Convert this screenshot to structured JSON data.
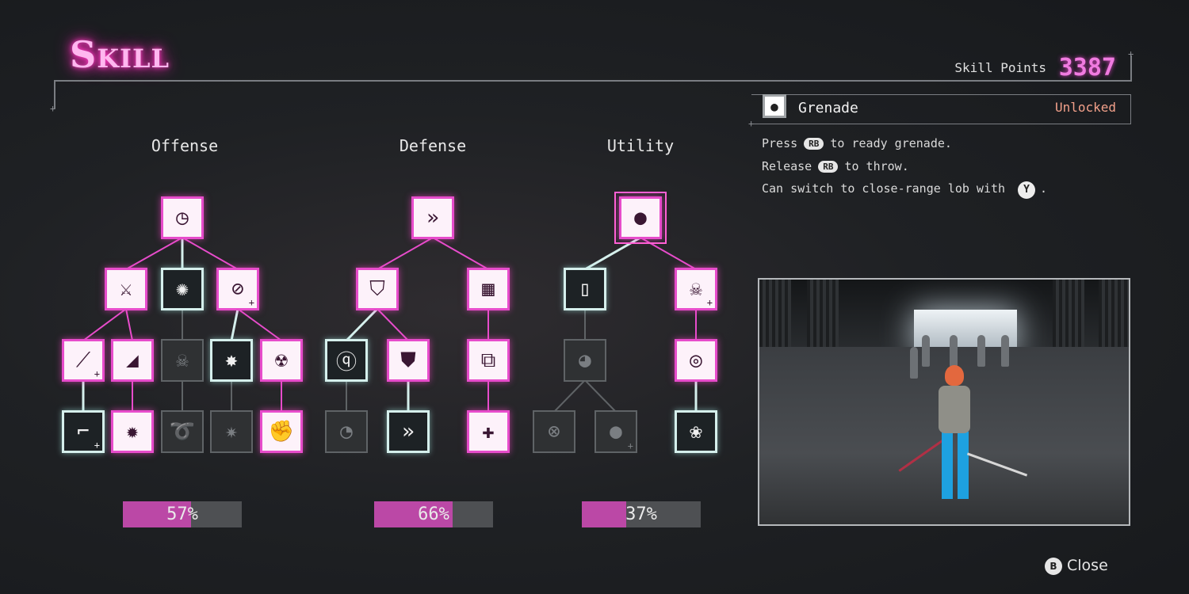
{
  "header": {
    "title": "Skill",
    "skill_points_label": "Skill Points",
    "skill_points_value": "3387"
  },
  "columns": [
    {
      "title": "Offense",
      "progress_label": "57%",
      "progress": 0.57
    },
    {
      "title": "Defense",
      "progress_label": "66%",
      "progress": 0.66
    },
    {
      "title": "Utility",
      "progress_label": "37%",
      "progress": 0.37
    }
  ],
  "nodes": {
    "offense_root": {
      "icon": "clock-icon",
      "state": "unlocked"
    },
    "offense_a1": {
      "icon": "slash-icon",
      "state": "unlocked"
    },
    "offense_a2": {
      "icon": "vortex-icon",
      "state": "active"
    },
    "offense_a3": {
      "icon": "crossed-dodge-icon",
      "state": "unlocked"
    },
    "offense_b1": {
      "icon": "blade-plus-icon",
      "state": "unlocked"
    },
    "offense_b2": {
      "icon": "wave-slash-icon",
      "state": "unlocked"
    },
    "offense_b3": {
      "icon": "skull-icon",
      "state": "locked"
    },
    "offense_b4": {
      "icon": "burst-icon",
      "state": "active"
    },
    "offense_b5": {
      "icon": "flame-skull-icon",
      "state": "unlocked"
    },
    "offense_c1": {
      "icon": "pistol-plus-icon",
      "state": "active"
    },
    "offense_c2": {
      "icon": "explosion-icon",
      "state": "unlocked"
    },
    "offense_c3": {
      "icon": "swirl-icon",
      "state": "locked"
    },
    "offense_c4": {
      "icon": "gear-burst-icon",
      "state": "locked"
    },
    "offense_c5": {
      "icon": "fist-icon",
      "state": "unlocked"
    },
    "defense_root": {
      "icon": "double-chevron-icon",
      "state": "unlocked"
    },
    "defense_a1": {
      "icon": "shield-icon",
      "state": "unlocked"
    },
    "defense_a2": {
      "icon": "medkit-icon",
      "state": "unlocked"
    },
    "defense_b1": {
      "icon": "parry-icon",
      "state": "active"
    },
    "defense_b2": {
      "icon": "crossed-shield-icon",
      "state": "unlocked"
    },
    "defense_b3": {
      "icon": "medkits-icon",
      "state": "unlocked"
    },
    "defense_c1": {
      "icon": "parry-timer-icon",
      "state": "locked"
    },
    "defense_c2": {
      "icon": "dash-timer-icon",
      "state": "active"
    },
    "defense_c3": {
      "icon": "heal-sparkle-icon",
      "state": "unlocked"
    },
    "utility_root": {
      "icon": "grenade-icon",
      "state": "unlocked"
    },
    "utility_a1": {
      "icon": "canister-icon",
      "state": "active"
    },
    "utility_a2": {
      "icon": "skull-plus-icon",
      "state": "unlocked"
    },
    "utility_b1": {
      "icon": "boot-timer-icon",
      "state": "locked"
    },
    "utility_b2": {
      "icon": "head-target-icon",
      "state": "unlocked"
    },
    "utility_c1": {
      "icon": "cancel-timer-icon",
      "state": "locked"
    },
    "utility_c2": {
      "icon": "grenade-plus-icon",
      "state": "locked"
    },
    "utility_c3": {
      "icon": "lotus-icon",
      "state": "active"
    }
  },
  "detail": {
    "name": "Grenade",
    "icon": "grenade-icon",
    "status": "Unlocked",
    "lines": [
      {
        "pre": "Press",
        "button": "RB",
        "post": "to ready grenade."
      },
      {
        "pre": "Release",
        "button": "RB",
        "post": "to throw."
      },
      {
        "pre": "Can switch to close-range lob with",
        "button": "Y",
        "post": "."
      }
    ]
  },
  "footer": {
    "close_button": "B",
    "close_label": "Close"
  },
  "colors": {
    "accent": "#e74ccb",
    "active": "#d5efec",
    "locked": "#5f6366",
    "progress": "#bb48a6"
  }
}
